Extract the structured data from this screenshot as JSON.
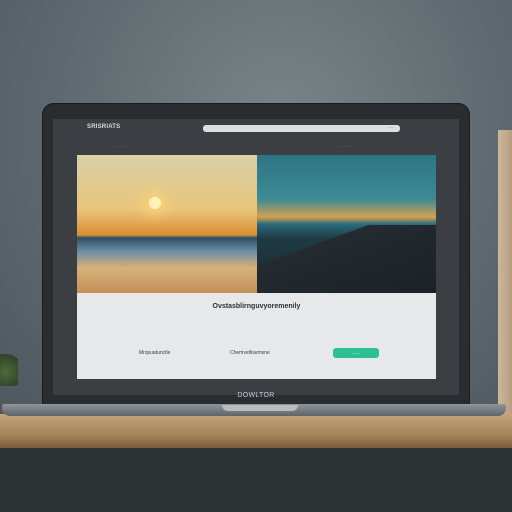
{
  "browser": {
    "logo_text": "SRISRIATS",
    "address_text": "·····",
    "nav_left": "—— ··",
    "nav_right": "——— ··"
  },
  "page": {
    "headline": "Ovstasblirnguvyoremenily",
    "footer_link_1": "Mrqsuatunctle",
    "footer_link_2": "Chemvetlisemsne",
    "cta_label": "———"
  },
  "device": {
    "brand": "DOWLTOR"
  },
  "colors": {
    "accent": "#2fbf94",
    "bezel": "#2a2d30",
    "content_bg": "#e6e8ea"
  }
}
